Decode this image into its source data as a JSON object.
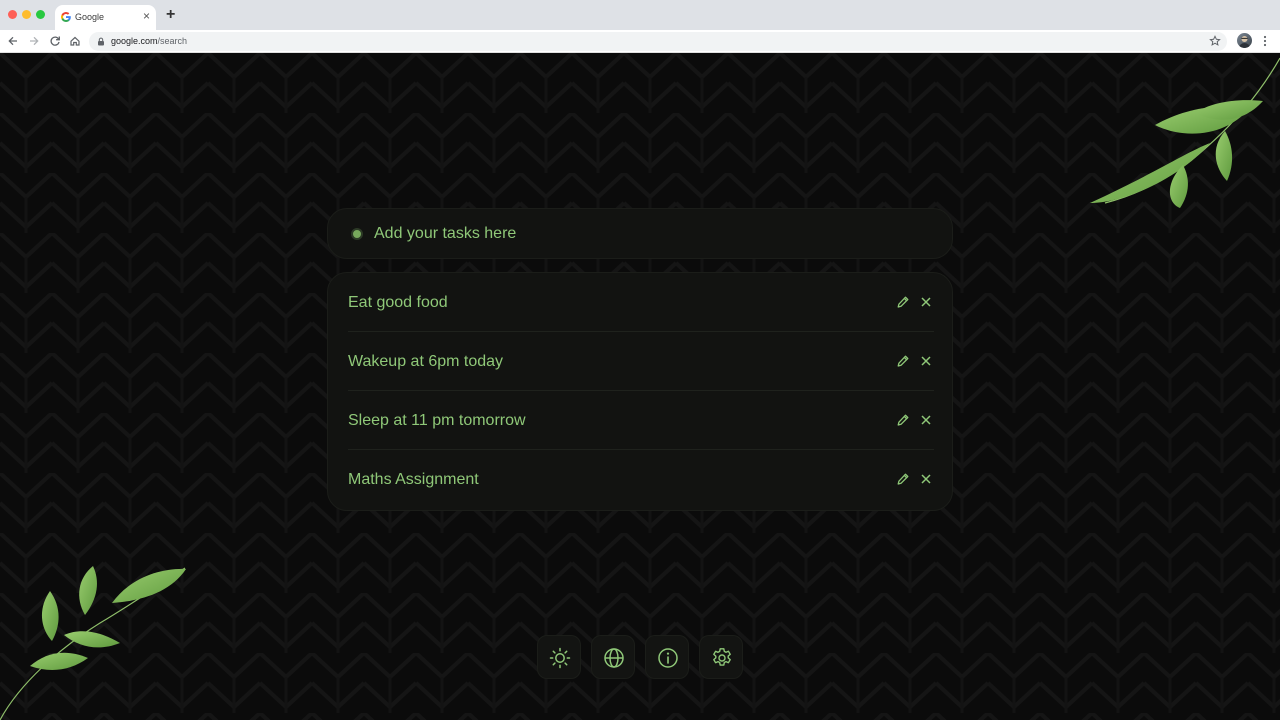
{
  "browser": {
    "tab_title": "Google",
    "url_host": "google.com",
    "url_path": "/search"
  },
  "icons": {
    "favicon": "google-g-icon",
    "tab_close": "close-icon",
    "new_tab": "plus-icon",
    "back": "arrow-left-icon",
    "forward": "arrow-right-icon",
    "reload": "reload-icon",
    "home": "home-icon",
    "lock": "lock-icon",
    "bookmark": "star-icon",
    "menu": "kebab-menu-icon",
    "task_bullet": "dot-icon",
    "edit": "pencil-icon",
    "delete": "close-icon",
    "theme": "sun-icon",
    "language": "globe-icon",
    "info": "info-icon",
    "settings": "gear-icon"
  },
  "task_input": {
    "placeholder": "Add your tasks here"
  },
  "tasks": [
    {
      "label": "Eat good food"
    },
    {
      "label": "Wakeup at 6pm today"
    },
    {
      "label": "Sleep at 11 pm tomorrow"
    },
    {
      "label": "Maths Assignment"
    }
  ],
  "colors": {
    "accent": "#8fc878",
    "background": "#0b0b0b",
    "card": "#121311",
    "leaf": "#7fb557"
  }
}
